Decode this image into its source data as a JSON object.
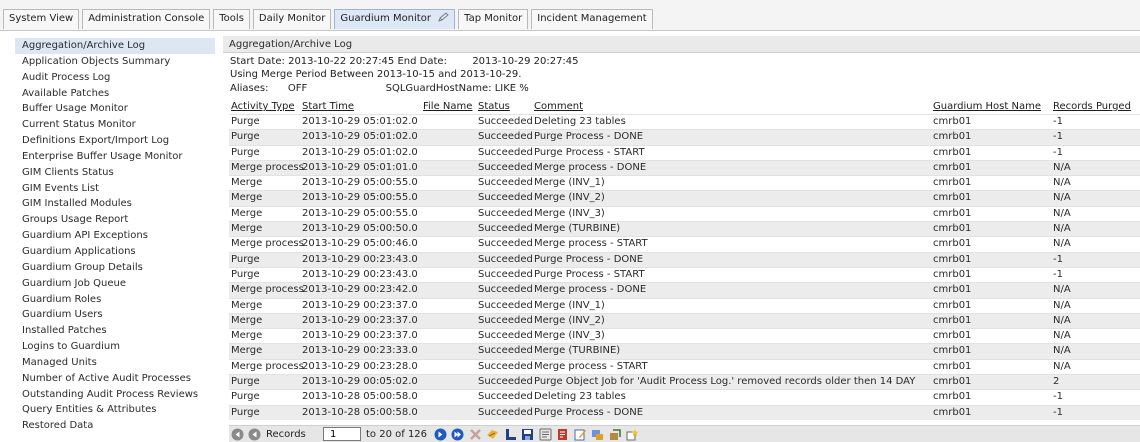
{
  "tabs": [
    {
      "label": "System View"
    },
    {
      "label": "Administration Console"
    },
    {
      "label": "Tools"
    },
    {
      "label": "Daily Monitor"
    },
    {
      "label": "Guardium Monitor"
    },
    {
      "label": "Tap Monitor"
    },
    {
      "label": "Incident Management"
    }
  ],
  "sidebar": {
    "items": [
      {
        "label": "Aggregation/Archive Log"
      },
      {
        "label": "Application Objects Summary"
      },
      {
        "label": "Audit Process Log"
      },
      {
        "label": "Available Patches"
      },
      {
        "label": "Buffer Usage Monitor"
      },
      {
        "label": "Current Status Monitor"
      },
      {
        "label": "Definitions Export/Import Log"
      },
      {
        "label": "Enterprise Buffer Usage Monitor"
      },
      {
        "label": "GIM Clients Status"
      },
      {
        "label": "GIM Events List"
      },
      {
        "label": "GIM Installed Modules"
      },
      {
        "label": "Groups Usage Report"
      },
      {
        "label": "Guardium API Exceptions"
      },
      {
        "label": "Guardium Applications"
      },
      {
        "label": "Guardium Group Details"
      },
      {
        "label": "Guardium Job Queue"
      },
      {
        "label": "Guardium Roles"
      },
      {
        "label": "Guardium Users"
      },
      {
        "label": "Installed Patches"
      },
      {
        "label": "Logins to Guardium"
      },
      {
        "label": "Managed Units"
      },
      {
        "label": "Number of Active Audit Processes"
      },
      {
        "label": "Outstanding Audit Process Reviews"
      },
      {
        "label": "Query Entities & Attributes"
      },
      {
        "label": "Restored Data"
      }
    ]
  },
  "report": {
    "title": "Aggregation/Archive Log",
    "start_label": "Start Date:",
    "start_value": "2013-10-22 20:27:45",
    "end_label": "End Date:",
    "end_value": "2013-10-29 20:27:45",
    "merge_period": "Using Merge Period Between 2013-10-15 and 2013-10-29.",
    "aliases_label": "Aliases:",
    "aliases_value": "OFF",
    "host_filter_label": "SQLGuardHostName:",
    "host_filter_value": "LIKE %"
  },
  "table": {
    "headers": {
      "activity": "Activity Type",
      "start": "Start Time",
      "file": "File Name",
      "status": "Status",
      "comment": "Comment",
      "host": "Guardium Host Name",
      "records": "Records Purged"
    },
    "rows": [
      {
        "activity": "Purge",
        "start": "2013-10-29 05:01:02.0",
        "file": "",
        "status": "Succeeded",
        "comment": "Deleting 23 tables",
        "host": "cmrb01",
        "records": "-1"
      },
      {
        "activity": "Purge",
        "start": "2013-10-29 05:01:02.0",
        "file": "",
        "status": "Succeeded",
        "comment": "Purge Process - DONE",
        "host": "cmrb01",
        "records": "-1"
      },
      {
        "activity": "Purge",
        "start": "2013-10-29 05:01:02.0",
        "file": "",
        "status": "Succeeded",
        "comment": "Purge Process - START",
        "host": "cmrb01",
        "records": "-1"
      },
      {
        "activity": "Merge process",
        "start": "2013-10-29 05:01:01.0",
        "file": "",
        "status": "Succeeded",
        "comment": "Merge process - DONE",
        "host": "cmrb01",
        "records": "N/A"
      },
      {
        "activity": "Merge",
        "start": "2013-10-29 05:00:55.0",
        "file": "",
        "status": "Succeeded",
        "comment": "Merge (INV_1)",
        "host": "cmrb01",
        "records": "N/A"
      },
      {
        "activity": "Merge",
        "start": "2013-10-29 05:00:55.0",
        "file": "",
        "status": "Succeeded",
        "comment": "Merge (INV_2)",
        "host": "cmrb01",
        "records": "N/A"
      },
      {
        "activity": "Merge",
        "start": "2013-10-29 05:00:55.0",
        "file": "",
        "status": "Succeeded",
        "comment": "Merge (INV_3)",
        "host": "cmrb01",
        "records": "N/A"
      },
      {
        "activity": "Merge",
        "start": "2013-10-29 05:00:50.0",
        "file": "",
        "status": "Succeeded",
        "comment": "Merge (TURBINE)",
        "host": "cmrb01",
        "records": "N/A"
      },
      {
        "activity": "Merge process",
        "start": "2013-10-29 05:00:46.0",
        "file": "",
        "status": "Succeeded",
        "comment": "Merge process - START",
        "host": "cmrb01",
        "records": "N/A"
      },
      {
        "activity": "Purge",
        "start": "2013-10-29 00:23:43.0",
        "file": "",
        "status": "Succeeded",
        "comment": "Purge Process - DONE",
        "host": "cmrb01",
        "records": "-1"
      },
      {
        "activity": "Purge",
        "start": "2013-10-29 00:23:43.0",
        "file": "",
        "status": "Succeeded",
        "comment": "Purge Process - START",
        "host": "cmrb01",
        "records": "-1"
      },
      {
        "activity": "Merge process",
        "start": "2013-10-29 00:23:42.0",
        "file": "",
        "status": "Succeeded",
        "comment": "Merge process - DONE",
        "host": "cmrb01",
        "records": "N/A"
      },
      {
        "activity": "Merge",
        "start": "2013-10-29 00:23:37.0",
        "file": "",
        "status": "Succeeded",
        "comment": "Merge (INV_1)",
        "host": "cmrb01",
        "records": "N/A"
      },
      {
        "activity": "Merge",
        "start": "2013-10-29 00:23:37.0",
        "file": "",
        "status": "Succeeded",
        "comment": "Merge (INV_2)",
        "host": "cmrb01",
        "records": "N/A"
      },
      {
        "activity": "Merge",
        "start": "2013-10-29 00:23:37.0",
        "file": "",
        "status": "Succeeded",
        "comment": "Merge (INV_3)",
        "host": "cmrb01",
        "records": "N/A"
      },
      {
        "activity": "Merge",
        "start": "2013-10-29 00:23:33.0",
        "file": "",
        "status": "Succeeded",
        "comment": "Merge (TURBINE)",
        "host": "cmrb01",
        "records": "N/A"
      },
      {
        "activity": "Merge process",
        "start": "2013-10-29 00:23:28.0",
        "file": "",
        "status": "Succeeded",
        "comment": "Merge process - START",
        "host": "cmrb01",
        "records": "N/A"
      },
      {
        "activity": "Purge",
        "start": "2013-10-29 00:05:02.0",
        "file": "",
        "status": "Succeeded",
        "comment": "Purge Object Job for 'Audit Process Log.' removed records older then 14 DAY",
        "host": "cmrb01",
        "records": "2"
      },
      {
        "activity": "Purge",
        "start": "2013-10-28 05:00:58.0",
        "file": "",
        "status": "Succeeded",
        "comment": "Deleting 23 tables",
        "host": "cmrb01",
        "records": "-1"
      },
      {
        "activity": "Purge",
        "start": "2013-10-28 05:00:58.0",
        "file": "",
        "status": "Succeeded",
        "comment": "Purge Process - DONE",
        "host": "cmrb01",
        "records": "-1"
      }
    ]
  },
  "pager": {
    "records_label": "Records",
    "current": "1",
    "range_text": "to 20 of 126"
  },
  "colors": {
    "selected_bg": "#dde7f3",
    "active_tab_bg": "#dce8f5",
    "nav_blue": "#1f5bbf"
  },
  "icons": {
    "tab_edit": "pencil-icon",
    "first": "first-page-icon",
    "prev": "previous-page-icon",
    "next": "next-page-icon",
    "last": "last-page-icon",
    "delete": "delete-icon",
    "refresh": "refresh-icon",
    "pdf": "pdf-icon",
    "save": "save-icon",
    "print": "print-icon",
    "export": "export-icon",
    "edit": "edit-icon",
    "schedule": "schedule-icon",
    "customize": "customize-icon",
    "favorite": "favorite-icon"
  }
}
